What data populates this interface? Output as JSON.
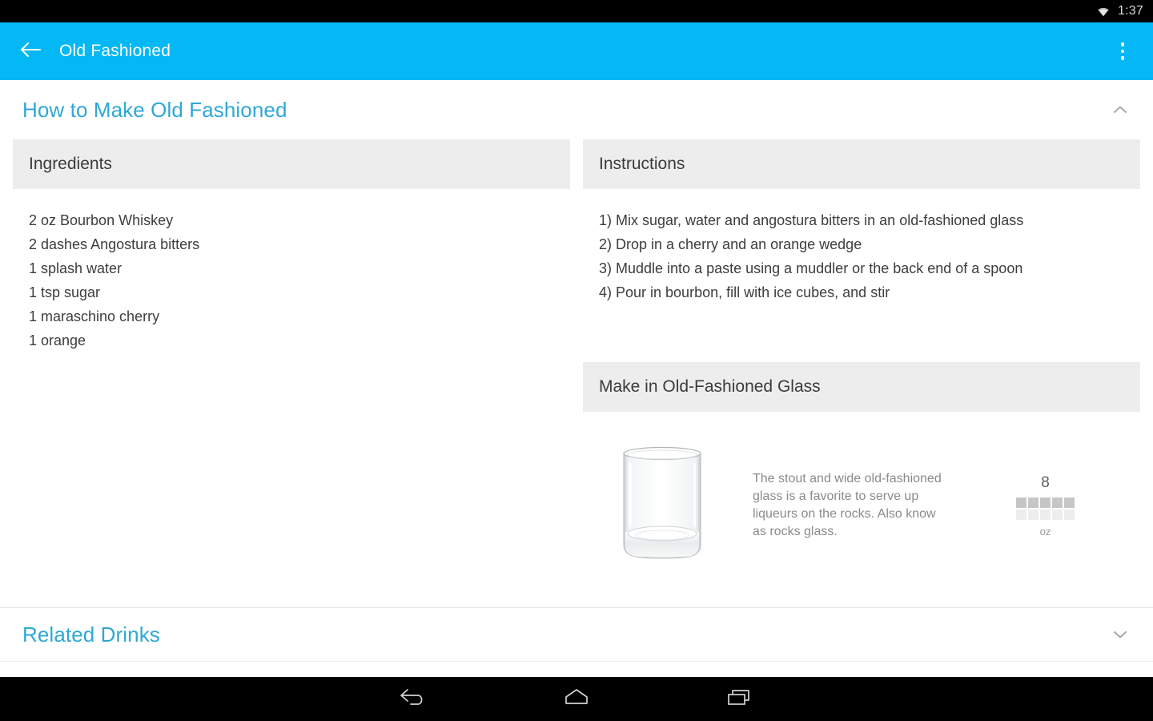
{
  "status_bar": {
    "time": "1:37",
    "wifi_icon": "wifi-icon"
  },
  "app_bar": {
    "back_icon": "arrow-left-icon",
    "title": "Old Fashioned",
    "overflow_icon": "more-vertical-icon",
    "background_color": "#03b8f5",
    "title_color": "#ffffff"
  },
  "sections": {
    "how_to": {
      "title": "How to Make Old Fashioned",
      "chevron_icon": "chevron-up-icon",
      "expanded": true,
      "title_color": "#2fa8d5"
    },
    "related": {
      "title": "Related Drinks",
      "chevron_icon": "chevron-down-icon",
      "expanded": false,
      "title_color": "#2fa8d5"
    }
  },
  "ingredients_panel": {
    "header": "Ingredients",
    "items": [
      "2 oz Bourbon Whiskey",
      "2 dashes Angostura bitters",
      "1 splash water",
      "1 tsp sugar",
      "1 maraschino cherry",
      "1 orange"
    ]
  },
  "instructions_panel": {
    "header": "Instructions",
    "steps": [
      "1) Mix sugar, water and angostura bitters in an old-fashioned glass",
      "2) Drop in a cherry and an orange wedge",
      "3) Muddle into a paste using a muddler or the back end of a spoon",
      "4) Pour in bourbon, fill with ice cubes, and stir"
    ]
  },
  "glass_panel": {
    "header": "Make in Old-Fashioned Glass",
    "image_icon": "rocks-glass-image",
    "description": "The stout and wide old-fashioned glass is a favorite to serve up liqueurs on the rocks. Also know as rocks glass.",
    "capacity": {
      "value": "8",
      "unit": "oz",
      "filled_cells": 5,
      "empty_cells": 5,
      "filled_color": "#c6c6c6",
      "empty_color": "#ededed"
    }
  },
  "nav_bar": {
    "back_icon": "nav-back-icon",
    "home_icon": "nav-home-icon",
    "recents_icon": "nav-recents-icon"
  }
}
